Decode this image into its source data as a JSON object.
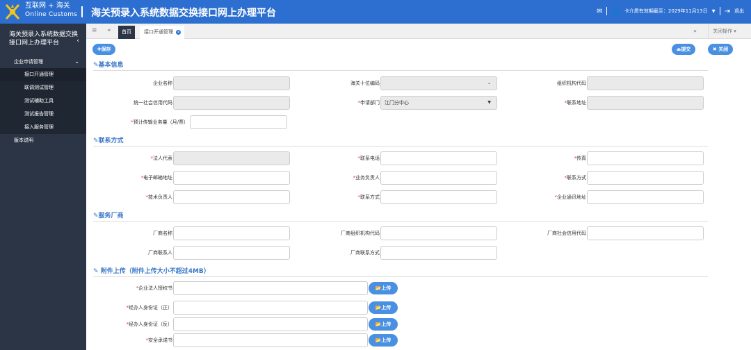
{
  "header": {
    "logo_line1": "互联网 + 海关",
    "logo_line2": "Online Customs",
    "title": "海关预录入系统数据交换接口网上办理平台",
    "cert_text": "卡介质有效期截至：2029年11月13日",
    "logout": "退出"
  },
  "sidebar": {
    "title": "海关预录入系统数据交换接口网上办理平台",
    "group": "企业申请管理",
    "items": [
      "接口开通管理",
      "联调测试管理",
      "测试辅助工具",
      "测试报告管理",
      "接入服务管理"
    ],
    "extra": "版本说明"
  },
  "tabs": {
    "home": "首页",
    "current": "接口开通管理",
    "close_ops": "关闭操作"
  },
  "toolbar": {
    "save": "保存",
    "submit": "提交",
    "close": "关闭"
  },
  "basic": {
    "section": "基本信息",
    "company_name": "企业名称",
    "customs_code": "海关十位编码",
    "org_code": "组织机构代码",
    "credit_code": "统一社会信用代码",
    "dept": "申请部门",
    "dept_value": "江门分中心",
    "address": "联系地址",
    "volume": "预计传输业务量（月/票）"
  },
  "contact": {
    "section": "联系方式",
    "legal_rep": "法人代表",
    "phone": "联系电话",
    "fax": "传真",
    "email": "电子邮箱地址",
    "biz_owner": "业务负责人",
    "contact_method": "联系方式",
    "tech_owner": "技术负责人",
    "contact_method2": "联系方式",
    "comm_addr": "企业通讯地址"
  },
  "vendor": {
    "section": "服务厂商",
    "name": "厂商名称",
    "org_code": "厂商组织机构代码",
    "credit_code": "厂商社会信用代码",
    "contact": "厂商联系人",
    "contact_method": "厂商联系方式"
  },
  "attach": {
    "section": "附件上传（附件上传大小不超过4MB）",
    "items": [
      "企业法人授权书",
      "经办人身份证（正）",
      "经办人身份证（反）",
      "安全承诺书"
    ],
    "upload": "上传"
  }
}
